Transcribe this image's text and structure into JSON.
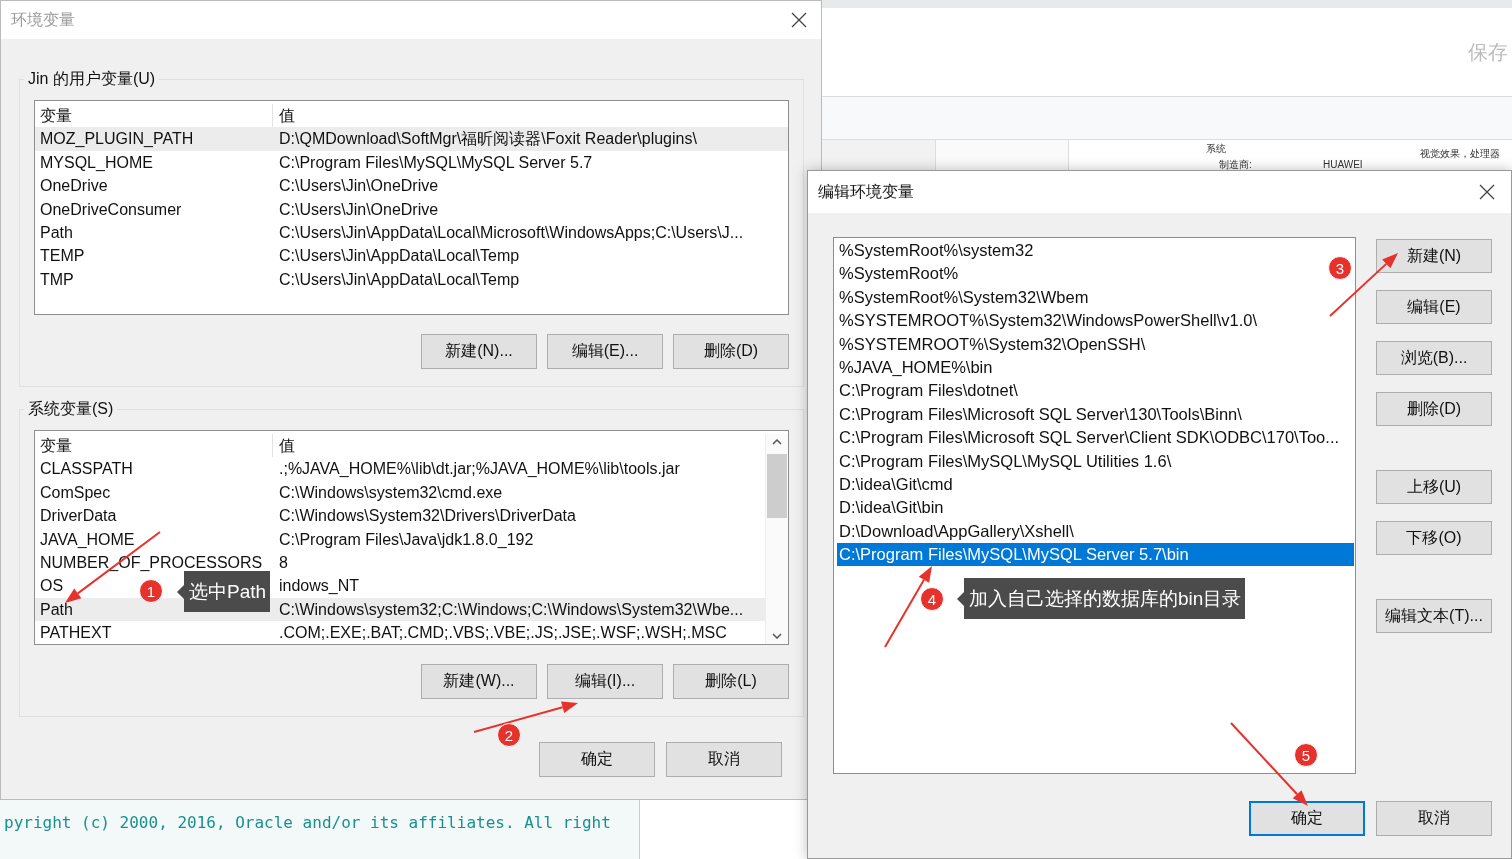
{
  "background_window": {
    "heading": "保存",
    "section_label": "系统",
    "manufacturer_label": "制造商:",
    "manufacturer": "HUAWEI",
    "side_text": "视觉效果，处理器"
  },
  "console": {
    "line": "pyright (c) 2000, 2016, Oracle and/or its affiliates. All right"
  },
  "env_dialog": {
    "title": "环境变量",
    "user_group": {
      "label": "Jin 的用户变量(U)",
      "columns": [
        "变量",
        "值"
      ],
      "rows": [
        {
          "name": "MOZ_PLUGIN_PATH",
          "value": "D:\\QMDownload\\SoftMgr\\福昕阅读器\\Foxit Reader\\plugins\\",
          "selected": true
        },
        {
          "name": "MYSQL_HOME",
          "value": "C:\\Program Files\\MySQL\\MySQL Server 5.7",
          "selected": false
        },
        {
          "name": "OneDrive",
          "value": "C:\\Users\\Jin\\OneDrive",
          "selected": false
        },
        {
          "name": "OneDriveConsumer",
          "value": "C:\\Users\\Jin\\OneDrive",
          "selected": false
        },
        {
          "name": "Path",
          "value": "C:\\Users\\Jin\\AppData\\Local\\Microsoft\\WindowsApps;C:\\Users\\J...",
          "selected": false
        },
        {
          "name": "TEMP",
          "value": "C:\\Users\\Jin\\AppData\\Local\\Temp",
          "selected": false
        },
        {
          "name": "TMP",
          "value": "C:\\Users\\Jin\\AppData\\Local\\Temp",
          "selected": false
        }
      ],
      "buttons": [
        "新建(N)...",
        "编辑(E)...",
        "删除(D)"
      ]
    },
    "system_group": {
      "label": "系统变量(S)",
      "columns": [
        "变量",
        "值"
      ],
      "rows": [
        {
          "name": "CLASSPATH",
          "value": ".;%JAVA_HOME%\\lib\\dt.jar;%JAVA_HOME%\\lib\\tools.jar",
          "selected": false
        },
        {
          "name": "ComSpec",
          "value": "C:\\Windows\\system32\\cmd.exe",
          "selected": false
        },
        {
          "name": "DriverData",
          "value": "C:\\Windows\\System32\\Drivers\\DriverData",
          "selected": false
        },
        {
          "name": "JAVA_HOME",
          "value": "C:\\Program Files\\Java\\jdk1.8.0_192",
          "selected": false
        },
        {
          "name": "NUMBER_OF_PROCESSORS",
          "value": "8",
          "selected": false
        },
        {
          "name": "OS",
          "value": "indows_NT",
          "selected": false
        },
        {
          "name": "Path",
          "value": "C:\\Windows\\system32;C:\\Windows;C:\\Windows\\System32\\Wbe...",
          "selected": true
        },
        {
          "name": "PATHEXT",
          "value": ".COM;.EXE;.BAT;.CMD;.VBS;.VBE;.JS;.JSE;.WSF;.WSH;.MSC",
          "selected": false
        }
      ],
      "buttons": [
        "新建(W)...",
        "编辑(I)...",
        "删除(L)"
      ]
    },
    "buttons": [
      {
        "label": "确定",
        "focused": false
      },
      {
        "label": "取消",
        "focused": false
      }
    ]
  },
  "edit_dialog": {
    "title": "编辑环境变量",
    "entries": [
      {
        "text": "%SystemRoot%\\system32",
        "selected": false
      },
      {
        "text": "%SystemRoot%",
        "selected": false
      },
      {
        "text": "%SystemRoot%\\System32\\Wbem",
        "selected": false
      },
      {
        "text": "%SYSTEMROOT%\\System32\\WindowsPowerShell\\v1.0\\",
        "selected": false
      },
      {
        "text": "%SYSTEMROOT%\\System32\\OpenSSH\\",
        "selected": false
      },
      {
        "text": "%JAVA_HOME%\\bin",
        "selected": false
      },
      {
        "text": "C:\\Program Files\\dotnet\\",
        "selected": false
      },
      {
        "text": "C:\\Program Files\\Microsoft SQL Server\\130\\Tools\\Binn\\",
        "selected": false
      },
      {
        "text": "C:\\Program Files\\Microsoft SQL Server\\Client SDK\\ODBC\\170\\Too...",
        "selected": false
      },
      {
        "text": "C:\\Program Files\\MySQL\\MySQL Utilities 1.6\\",
        "selected": false
      },
      {
        "text": "D:\\idea\\Git\\cmd",
        "selected": false
      },
      {
        "text": "D:\\idea\\Git\\bin",
        "selected": false
      },
      {
        "text": "D:\\Download\\AppGallery\\Xshell\\",
        "selected": false
      },
      {
        "text": "C:\\Program Files\\MySQL\\MySQL Server 5.7\\bin",
        "selected": true
      }
    ],
    "buttons": [
      "新建(N)",
      "编辑(E)",
      "浏览(B)...",
      "删除(D)",
      "上移(U)",
      "下移(O)",
      "编辑文本(T)..."
    ],
    "footer_buttons": [
      {
        "label": "确定",
        "focused": true
      },
      {
        "label": "取消",
        "focused": false
      }
    ]
  },
  "annotations": [
    {
      "number": "1",
      "text": "选中Path"
    },
    {
      "number": "2"
    },
    {
      "number": "3"
    },
    {
      "number": "4",
      "text": "加入自己选择的数据库的bin目录"
    },
    {
      "number": "5"
    }
  ]
}
